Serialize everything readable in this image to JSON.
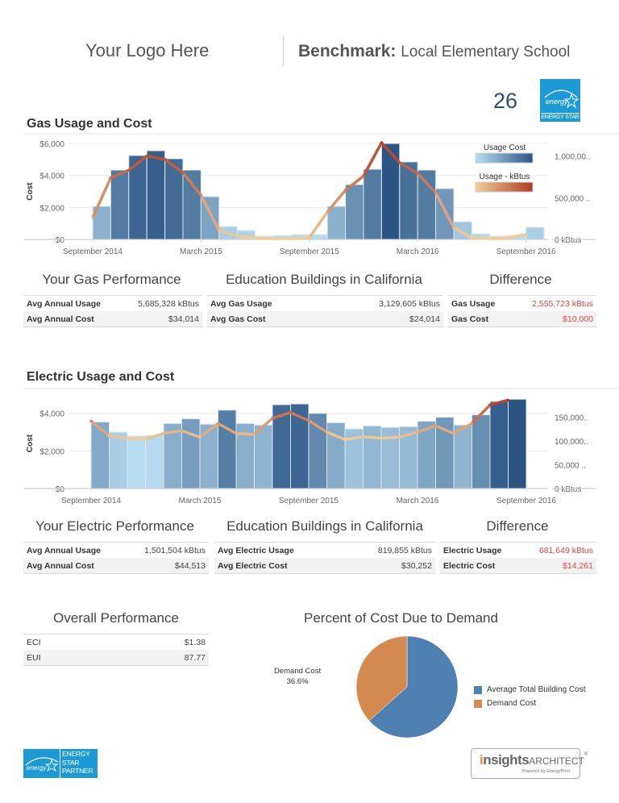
{
  "header": {
    "logo_text": "Your Logo Here",
    "benchmark_label": "Benchmark:",
    "building_name": "Local Elementary School",
    "energy_star_score": "26",
    "energy_star_badge": "ENERGY STAR"
  },
  "gas": {
    "section_title": "Gas Usage and Cost",
    "performance": {
      "yours_title": "Your Gas Performance",
      "yours_rows": [
        {
          "label": "Avg Annual Usage",
          "value": "5,685,328 kBtus"
        },
        {
          "label": "Avg Annual Cost",
          "value": "$34,014"
        }
      ],
      "benchmark_title": "Education Buildings in California",
      "benchmark_rows": [
        {
          "label": "Avg Gas Usage",
          "value": "3,129,605 kBtus"
        },
        {
          "label": "Avg Gas Cost",
          "value": "$24,014"
        }
      ],
      "difference_title": "Difference",
      "difference_rows": [
        {
          "label": "Gas Usage",
          "value": "2,555,723 kBtus"
        },
        {
          "label": "Gas Cost",
          "value": "$10,000"
        }
      ]
    }
  },
  "electric": {
    "section_title": "Electric Usage and Cost",
    "performance": {
      "yours_title": "Your Electric Performance",
      "yours_rows": [
        {
          "label": "Avg Annual Usage",
          "value": "1,501,504 kBtus"
        },
        {
          "label": "Avg Annual Cost",
          "value": "$44,513"
        }
      ],
      "benchmark_title": "Education Buildings in California",
      "benchmark_rows": [
        {
          "label": "Avg Electric Usage",
          "value": "819,855 kBtus"
        },
        {
          "label": "Avg Electric Cost",
          "value": "$30,252"
        }
      ],
      "difference_title": "Difference",
      "difference_rows": [
        {
          "label": "Electric Usage",
          "value": "681,649 kBtus"
        },
        {
          "label": "Electric Cost",
          "value": "$14,261"
        }
      ]
    }
  },
  "overall": {
    "title": "Overall Performance",
    "rows": [
      {
        "label": "ECI",
        "value": "$1.38"
      },
      {
        "label": "EUI",
        "value": "87.77"
      }
    ]
  },
  "colors": {
    "cost_light": "#b8dcf0",
    "cost_dark": "#2b5684",
    "usage_light": "#f1cf9a",
    "usage_dark": "#b03a26",
    "difference_red": "#e04545",
    "pie_total": "#4e81b2",
    "pie_demand": "#d4894f",
    "energy_star_blue": "#1b9ad6"
  },
  "footer": {
    "partner_logo_lines": [
      "ENERGY",
      "STAR",
      "PARTNER"
    ],
    "insights_i": "i",
    "insights_rest": "nsights",
    "insights_architect": "ARCHITECT",
    "insights_tm": "®",
    "insights_sub": "Powered by EnergyPrint"
  },
  "chart_data": [
    {
      "id": "gas",
      "type": "bar",
      "title": "Gas Usage and Cost",
      "xlabel": "",
      "ylabel": "Cost",
      "y2label": "",
      "x_tick_labels": [
        {
          "label": "September 2014",
          "index": 0
        },
        {
          "label": "March 2015",
          "index": 6
        },
        {
          "label": "September 2015",
          "index": 12
        },
        {
          "label": "March 2016",
          "index": 18
        },
        {
          "label": "September 2016",
          "index": 24
        }
      ],
      "categories": [
        "Sep 2014",
        "Oct 2014",
        "Nov 2014",
        "Dec 2014",
        "Jan 2015",
        "Feb 2015",
        "Mar 2015",
        "Apr 2015",
        "May 2015",
        "Jun 2015",
        "Jul 2015",
        "Aug 2015",
        "Sep 2015",
        "Oct 2015",
        "Nov 2015",
        "Dec 2015",
        "Jan 2016",
        "Feb 2016",
        "Mar 2016",
        "Apr 2016",
        "May 2016",
        "Jun 2016",
        "Jul 2016",
        "Aug 2016",
        "Sep 2016"
      ],
      "series": [
        {
          "name": "Usage Cost",
          "type": "bar",
          "axis": "left",
          "values": [
            2070,
            4340,
            5250,
            5550,
            5050,
            4340,
            2680,
            810,
            560,
            200,
            250,
            300,
            300,
            2070,
            3430,
            4390,
            6000,
            4850,
            4340,
            3180,
            1110,
            350,
            200,
            250,
            760
          ]
        },
        {
          "name": "Usage - kBtus",
          "type": "line",
          "axis": "right",
          "values": [
            260000,
            740000,
            830000,
            1000000,
            960000,
            800000,
            530000,
            110000,
            40000,
            20000,
            10000,
            10000,
            20000,
            330000,
            590000,
            760000,
            1160000,
            920000,
            790000,
            560000,
            140000,
            20000,
            10000,
            20000,
            60000
          ]
        }
      ],
      "ylim": [
        0,
        6000
      ],
      "y_ticks": [
        {
          "value": 0,
          "label": "$0"
        },
        {
          "value": 2000,
          "label": "$2,000"
        },
        {
          "value": 4000,
          "label": "$4,000"
        },
        {
          "value": 6000,
          "label": "$6,000"
        }
      ],
      "y2lim": [
        0,
        1150000
      ],
      "y2_ticks": [
        {
          "value": 0,
          "label": "0 kBtus"
        },
        {
          "value": 500000,
          "label": "500,000 .."
        },
        {
          "value": 1000000,
          "label": "1,000,00.."
        }
      ],
      "legend": [
        {
          "label": "Usage Cost",
          "gradient": [
            "#b8dcf0",
            "#2b5684"
          ]
        },
        {
          "label": "Usage - kBtus",
          "gradient": [
            "#f1cf9a",
            "#b03a26"
          ]
        }
      ],
      "legend_position": "top-right",
      "grid": true
    },
    {
      "id": "electric",
      "type": "bar",
      "title": "Electric Usage and Cost",
      "xlabel": "",
      "ylabel": "Cost",
      "x_tick_labels": [
        {
          "label": "September 2014",
          "index": 0
        },
        {
          "label": "March 2015",
          "index": 6
        },
        {
          "label": "September 2015",
          "index": 12
        },
        {
          "label": "March 2016",
          "index": 18
        },
        {
          "label": "September 2016",
          "index": 24
        }
      ],
      "categories": [
        "Sep 2014",
        "Oct 2014",
        "Nov 2014",
        "Dec 2014",
        "Jan 2015",
        "Feb 2015",
        "Mar 2015",
        "Apr 2015",
        "May 2015",
        "Jun 2015",
        "Jul 2015",
        "Aug 2015",
        "Sep 2015",
        "Oct 2015",
        "Nov 2015",
        "Dec 2015",
        "Jan 2016",
        "Feb 2016",
        "Mar 2016",
        "Apr 2016",
        "May 2016",
        "Jun 2016",
        "Jul 2016",
        "Aug 2016"
      ],
      "series": [
        {
          "name": "Usage Cost",
          "type": "bar",
          "axis": "left",
          "values": [
            3540,
            3000,
            2790,
            2830,
            3460,
            3710,
            3420,
            4170,
            3460,
            3380,
            4460,
            4500,
            4000,
            3500,
            3170,
            3330,
            3250,
            3290,
            3580,
            3790,
            3380,
            3920,
            4630,
            4750
          ]
        },
        {
          "name": "Usage - kBtus",
          "type": "line",
          "axis": "right",
          "values": [
            142000,
            111000,
            106000,
            104000,
            116000,
            122000,
            108000,
            137000,
            116000,
            114000,
            148000,
            160000,
            143000,
            119000,
            103000,
            109000,
            106000,
            108000,
            119000,
            132000,
            116000,
            137000,
            176000,
            186000
          ]
        }
      ],
      "ylim": [
        0,
        4800
      ],
      "y_ticks": [
        {
          "value": 0,
          "label": "$0"
        },
        {
          "value": 2000,
          "label": "$2,000"
        },
        {
          "value": 4000,
          "label": "$4,000"
        }
      ],
      "y2lim": [
        0,
        190000
      ],
      "y2_ticks": [
        {
          "value": 0,
          "label": "0 kBtus"
        },
        {
          "value": 50000,
          "label": "50,000 .."
        },
        {
          "value": 100000,
          "label": "100,000.."
        },
        {
          "value": 150000,
          "label": "150,000.."
        }
      ],
      "grid": true
    },
    {
      "id": "demand",
      "type": "pie",
      "title": "Percent of  Cost Due to Demand",
      "slices": [
        {
          "label": "Average Total Building Cost",
          "value": 63.4,
          "color": "#4e81b2"
        },
        {
          "label": "Demand Cost",
          "value": 36.6,
          "color": "#d4894f"
        }
      ],
      "annotation": {
        "label": "Demand Cost",
        "value": "36.6%"
      },
      "legend": [
        "Average Total Building Cost",
        "Demand Cost"
      ],
      "legend_position": "right"
    }
  ]
}
